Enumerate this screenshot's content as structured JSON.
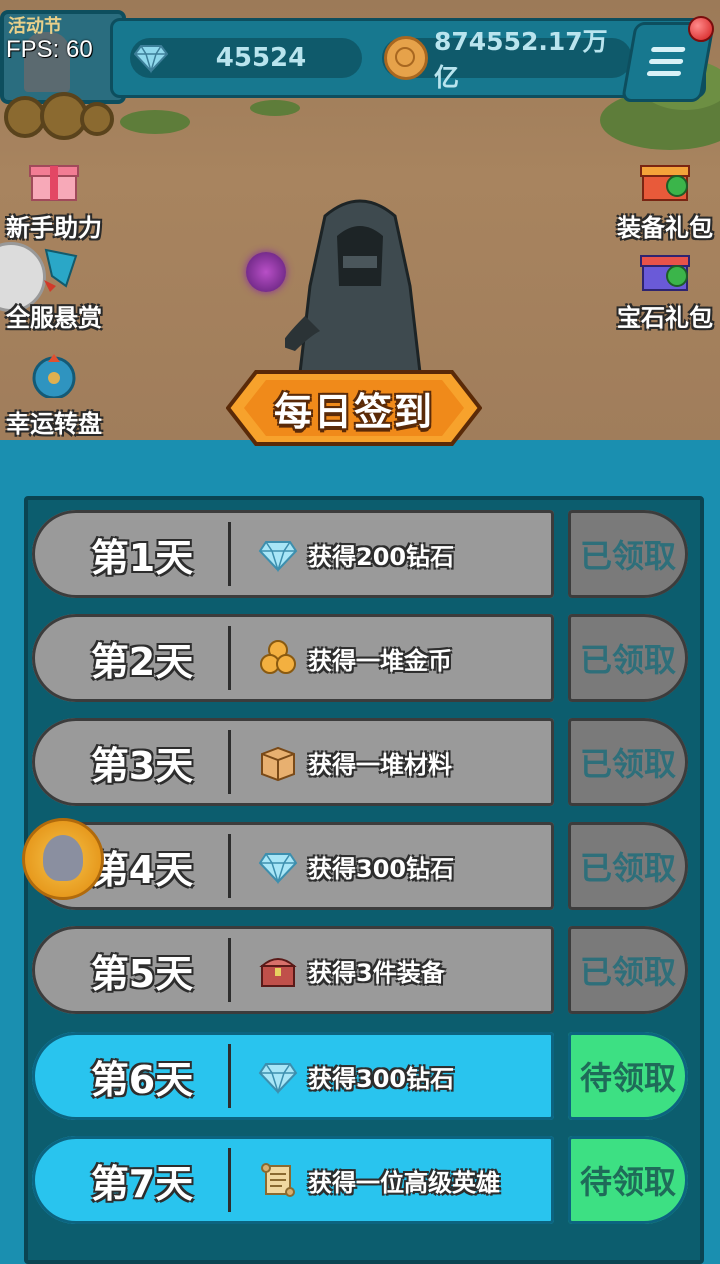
{
  "hud": {
    "fps_label": "FPS:",
    "fps_value": "60",
    "avatar_caption": "活动节",
    "diamonds": "45524",
    "gold": "874552.17万亿"
  },
  "side_left": [
    {
      "label": "新手助力",
      "icon": "gift-icon"
    },
    {
      "label": "全服悬赏",
      "icon": "bounty-icon"
    },
    {
      "label": "幸运转盘",
      "icon": "wheel-icon"
    }
  ],
  "side_right": [
    {
      "label": "装备礼包",
      "icon": "gift-icon"
    },
    {
      "label": "宝石礼包",
      "icon": "gift-icon"
    }
  ],
  "banner": {
    "title": "每日签到"
  },
  "days": [
    {
      "day": "第1天",
      "reward": "获得200钻石",
      "icon": "diamond-icon",
      "status": "已领取",
      "state": "claimed"
    },
    {
      "day": "第2天",
      "reward": "获得一堆金币",
      "icon": "coin-bag-icon",
      "status": "已领取",
      "state": "claimed"
    },
    {
      "day": "第3天",
      "reward": "获得一堆材料",
      "icon": "box-icon",
      "status": "已领取",
      "state": "claimed"
    },
    {
      "day": "第4天",
      "reward": "获得300钻石",
      "icon": "diamond-icon",
      "status": "已领取",
      "state": "claimed"
    },
    {
      "day": "第5天",
      "reward": "获得3件装备",
      "icon": "chest-icon",
      "status": "已领取",
      "state": "claimed"
    },
    {
      "day": "第6天",
      "reward": "获得300钻石",
      "icon": "diamond-icon",
      "status": "待领取",
      "state": "pending"
    },
    {
      "day": "第7天",
      "reward": "获得一位高级英雄",
      "icon": "scroll-icon",
      "status": "待领取",
      "state": "pending"
    }
  ],
  "colors": {
    "claimed_row": "#9a9a9a",
    "pending_row": "#29c4ee",
    "pending_button": "#3de083",
    "panel": "#0c5d6e"
  }
}
